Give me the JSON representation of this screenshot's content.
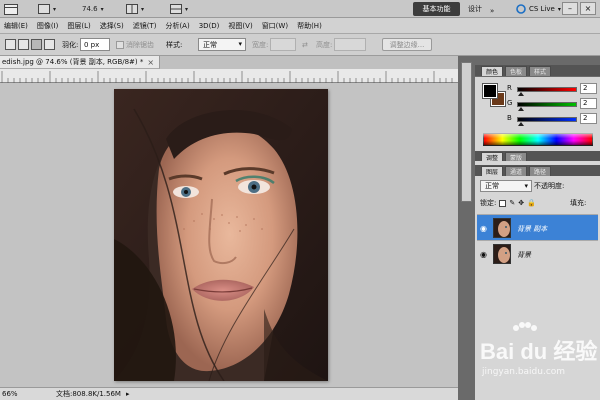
{
  "app": {
    "zoom_dropdown": "74.6",
    "workspace_active": "基本功能",
    "workspace_design": "设计",
    "cs_live": "CS Live",
    "win_min": "–",
    "win_close": "×"
  },
  "menu": [
    "编辑(E)",
    "图像(I)",
    "图层(L)",
    "选择(S)",
    "滤镜(T)",
    "分析(A)",
    "3D(D)",
    "视图(V)",
    "窗口(W)",
    "帮助(H)"
  ],
  "options": {
    "feather_label": "羽化:",
    "feather_value": "0 px",
    "antialias_label": "消除锯齿",
    "style_label": "样式:",
    "style_value": "正常",
    "width_label": "宽度:",
    "height_label": "高度:",
    "refine_edge": "调整边缘..."
  },
  "document": {
    "tab_title": "edish.jpg @ 74.6% (背景 副本, RGB/8#) *",
    "status_zoom": "66%",
    "status_doc": "文档:808.8K/1.56M"
  },
  "panels": {
    "color_tabs": [
      "颜色",
      "色板",
      "样式"
    ],
    "color_sliders": [
      {
        "label": "R",
        "value": "2",
        "color": "#e02020"
      },
      {
        "label": "G",
        "value": "2",
        "color": "#20b020"
      },
      {
        "label": "B",
        "value": "2",
        "color": "#2040e0"
      }
    ],
    "adjust_tabs": [
      "调整",
      "蒙版"
    ],
    "layers_tabs": [
      "图层",
      "通道",
      "路径"
    ],
    "blend_mode": "正常",
    "opacity_label": "不透明度:",
    "lock_label": "锁定:",
    "fill_label": "填充:",
    "layers": [
      {
        "name": "背景 副本",
        "selected": true
      },
      {
        "name": "背景",
        "selected": false
      }
    ]
  },
  "watermark": {
    "main": "Bai du 经验",
    "sub": "jingyan.baidu.com"
  },
  "colors": {
    "selection_blue": "#3c82d6",
    "panel_bg": "#d6d6d6",
    "foreground": "#000000",
    "background_swatch": "#6b3a1a"
  }
}
